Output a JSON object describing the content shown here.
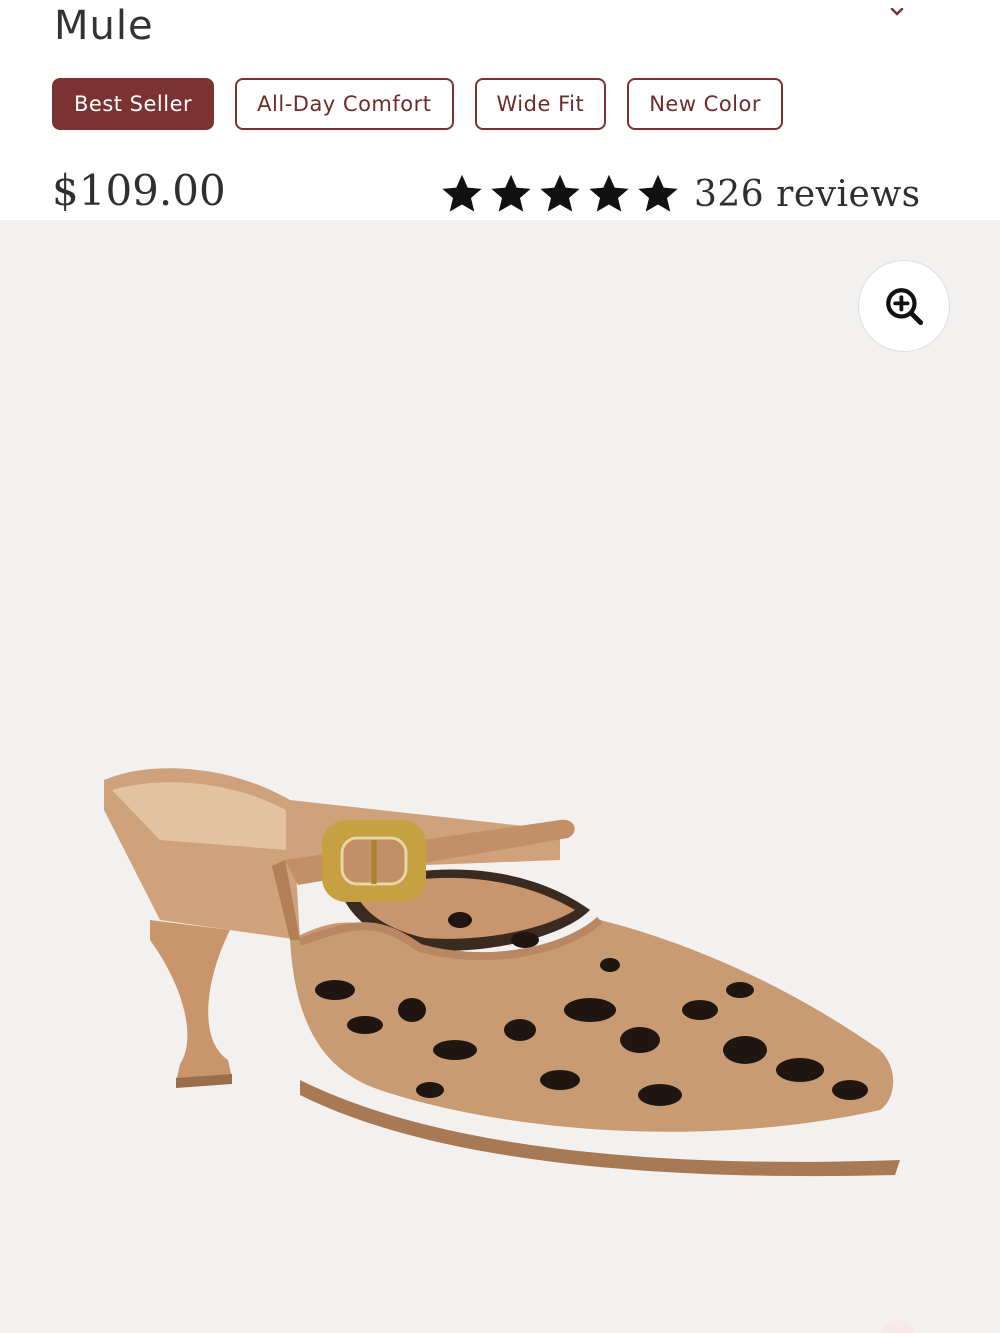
{
  "product": {
    "title": "Mule",
    "price": "$109.00",
    "rating": 5,
    "rating_max": 5,
    "reviews_label": "326 reviews"
  },
  "badges": [
    {
      "label": "Best Seller",
      "filled": true
    },
    {
      "label": "All-Day Comfort",
      "filled": false
    },
    {
      "label": "Wide Fit",
      "filled": false
    },
    {
      "label": "New Color",
      "filled": false
    }
  ],
  "gallery": {
    "zoom_icon": "zoom-in-icon",
    "background_color": "#f3f1ef"
  },
  "colors": {
    "accent": "#7b3331",
    "text": "#2f2f2f",
    "star": "#111111"
  }
}
